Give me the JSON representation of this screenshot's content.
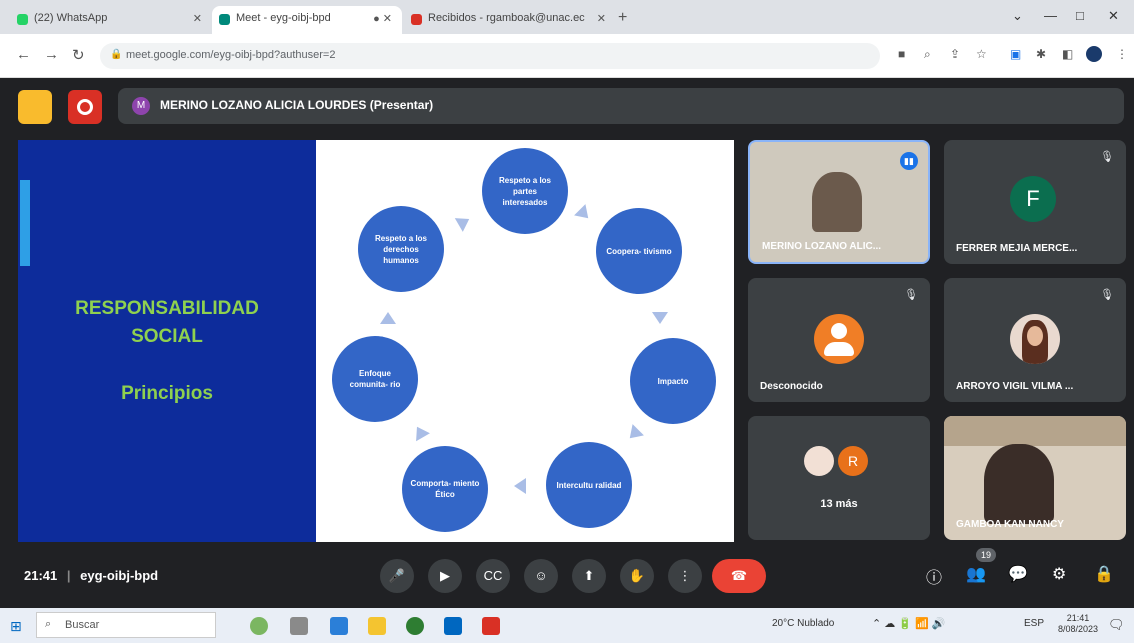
{
  "browser": {
    "tabs": [
      {
        "title": "(22) WhatsApp",
        "favicon_color": "#25d366"
      },
      {
        "title": "Meet - eyg-oibj-bpd",
        "favicon_color": "#00897b",
        "active": true
      },
      {
        "title": "Recibidos - rgamboak@unac.ec",
        "favicon_color": "#d93025"
      }
    ],
    "url": "meet.google.com/eyg-oibj-bpd?authuser=2"
  },
  "meet": {
    "presenter_banner": "MERINO LOZANO ALICIA LOURDES (Presentar)",
    "presenter_initial": "M",
    "meeting_time": "21:41",
    "meeting_code": "eyg-oibj-bpd",
    "participant_count": "19"
  },
  "slide": {
    "title_line1": "RESPONSABILIDAD",
    "title_line2": "SOCIAL",
    "subtitle": "Principios",
    "circles": [
      "Respeto a los partes interesados",
      "Coopera- tivismo",
      "Impacto",
      "Intercultu ralidad",
      "Comporta- miento Ético",
      "Enfoque comunita- rio",
      "Respeto a los derechos humanos"
    ]
  },
  "tiles": [
    {
      "name": "MERINO LOZANO ALIC...",
      "type": "video"
    },
    {
      "name": "FERRER MEJIA MERCE...",
      "initial": "F",
      "color": "#0b6e4f"
    },
    {
      "name": "Desconocido",
      "type": "anonymous"
    },
    {
      "name": "ARROYO VIGIL VILMA ...",
      "type": "photo"
    },
    {
      "name": "13 más",
      "initial": "R",
      "color": "#e8711a"
    },
    {
      "name": "GAMBOA KAN NANCY",
      "type": "video"
    }
  ],
  "taskbar": {
    "search_placeholder": "Buscar",
    "weather": "20°C Nublado",
    "clock_time": "21:41",
    "clock_date": "8/08/2023"
  },
  "colors": {
    "end_call": "#ea4335",
    "slide_blue": "#0d2c9b",
    "circle_blue": "#3366c7",
    "accent_green": "#8fd14f"
  }
}
